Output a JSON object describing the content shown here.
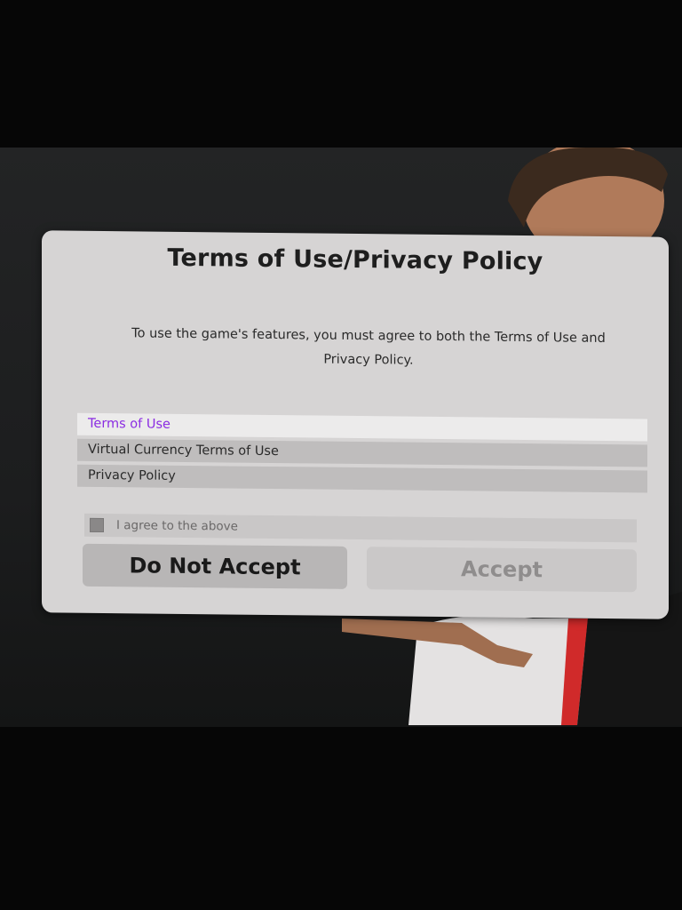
{
  "dialog": {
    "title": "Terms of Use/Privacy Policy",
    "message_line1": "To use the game's features, you must agree to both the Terms of Use and",
    "message_line2": "Privacy Policy.",
    "documents": [
      {
        "label": "Terms of Use",
        "selected": true
      },
      {
        "label": "Virtual Currency Terms of Use",
        "selected": false
      },
      {
        "label": "Privacy Policy",
        "selected": false
      }
    ],
    "agree_label": "I agree to the above",
    "agree_checked": false,
    "decline_label": "Do Not Accept",
    "accept_label": "Accept",
    "accept_enabled": false
  },
  "colors": {
    "dialog_bg": "#d6d4d4",
    "selected_text": "#8a2be2",
    "disabled_text": "#8f8d8d"
  }
}
